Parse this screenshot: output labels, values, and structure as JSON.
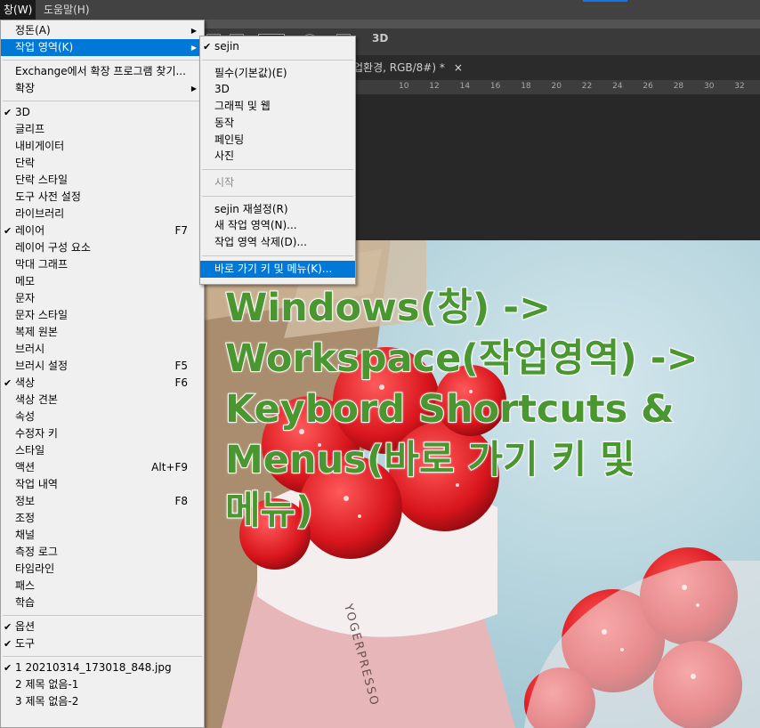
{
  "menubar": {
    "window": "창(W)",
    "help": "도움말(H)"
  },
  "options_bar": {
    "mode_3d": "3D"
  },
  "document_tab": {
    "title": "업환경, RGB/8#) *",
    "close": "×"
  },
  "ruler": {
    "ticks": [
      "10",
      "12",
      "14",
      "16",
      "18",
      "20",
      "22",
      "24",
      "26",
      "28",
      "30",
      "32"
    ]
  },
  "window_menu": {
    "items": [
      {
        "label": "정돈(A)",
        "submenu": true
      },
      {
        "label": "작업 영역(K)",
        "submenu": true,
        "highlighted": true
      },
      {
        "sep": true
      },
      {
        "label": "Exchange에서 확장 프로그램 찾기..."
      },
      {
        "label": "확장",
        "submenu": true
      },
      {
        "sep": true
      },
      {
        "label": "3D",
        "checked": true
      },
      {
        "label": "글리프"
      },
      {
        "label": "내비게이터"
      },
      {
        "label": "단락"
      },
      {
        "label": "단락 스타일"
      },
      {
        "label": "도구 사전 설정"
      },
      {
        "label": "라이브러리"
      },
      {
        "label": "레이어",
        "checked": true,
        "shortcut": "F7"
      },
      {
        "label": "레이어 구성 요소"
      },
      {
        "label": "막대 그래프"
      },
      {
        "label": "메모"
      },
      {
        "label": "문자"
      },
      {
        "label": "문자 스타일"
      },
      {
        "label": "복제 원본"
      },
      {
        "label": "브러시"
      },
      {
        "label": "브러시 설정",
        "shortcut": "F5"
      },
      {
        "label": "색상",
        "checked": true,
        "shortcut": "F6"
      },
      {
        "label": "색상 견본"
      },
      {
        "label": "속성"
      },
      {
        "label": "수정자 키"
      },
      {
        "label": "스타일"
      },
      {
        "label": "액션",
        "shortcut": "Alt+F9"
      },
      {
        "label": "작업 내역"
      },
      {
        "label": "정보",
        "shortcut": "F8"
      },
      {
        "label": "조정"
      },
      {
        "label": "채널"
      },
      {
        "label": "측정 로그"
      },
      {
        "label": "타임라인"
      },
      {
        "label": "패스"
      },
      {
        "label": "학습"
      },
      {
        "sep": true
      },
      {
        "label": "옵션",
        "checked": true
      },
      {
        "label": "도구",
        "checked": true
      },
      {
        "sep": true
      },
      {
        "label": "1 20210314_173018_848.jpg",
        "checked": true
      },
      {
        "label": "2 제목 없음-1"
      },
      {
        "label": "3 제목 없음-2"
      }
    ]
  },
  "workspace_menu": {
    "items": [
      {
        "label": "sejin",
        "checked": true
      },
      {
        "sep": true
      },
      {
        "label": "필수(기본값)(E)"
      },
      {
        "label": "3D"
      },
      {
        "label": "그래픽 및 웹"
      },
      {
        "label": "동작"
      },
      {
        "label": "페인팅"
      },
      {
        "label": "사진"
      },
      {
        "sep": true
      },
      {
        "label": "시작",
        "disabled": true
      },
      {
        "sep": true
      },
      {
        "label": "sejin 재설정(R)"
      },
      {
        "label": "새 작업 영역(N)..."
      },
      {
        "label": "작업 영역 삭제(D)..."
      },
      {
        "sep": true
      },
      {
        "label": "바로 가기 키 및 메뉴(K)...",
        "highlighted": true
      }
    ]
  },
  "overlay": {
    "lines": [
      "Windows(창) ->",
      "Workspace(작업영역) ->",
      "Keybord Shortcuts &",
      "Menus(바로 가기 키 및",
      "메뉴)"
    ],
    "color": "#4a9630"
  },
  "photo": {
    "cup_print": "YOGERPRESSO"
  }
}
